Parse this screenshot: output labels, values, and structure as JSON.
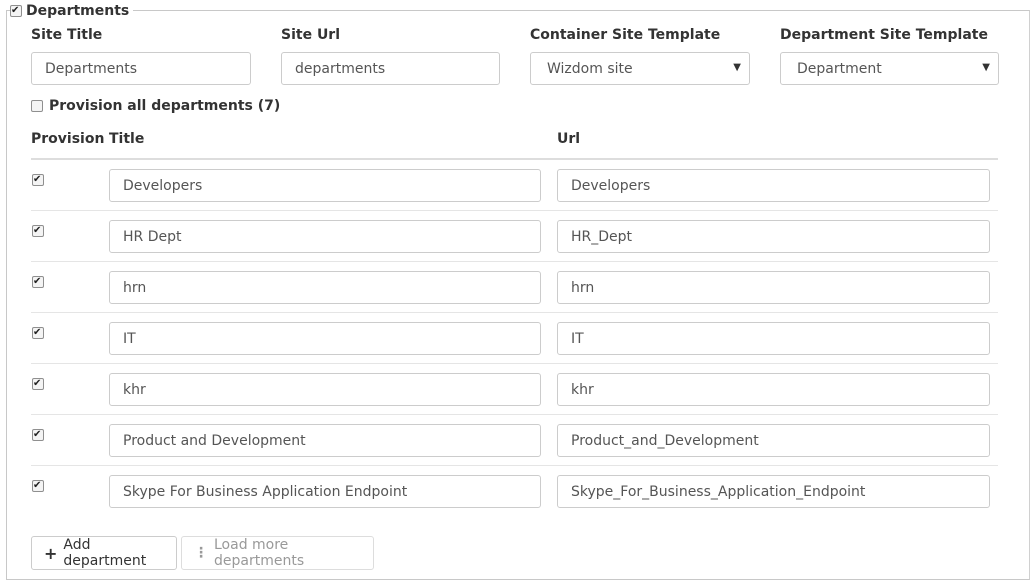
{
  "section": {
    "label": "Departments",
    "checked": true
  },
  "fields": {
    "site_title": {
      "label": "Site Title",
      "value": "Departments"
    },
    "site_url": {
      "label": "Site Url",
      "value": "departments"
    },
    "container_template": {
      "label": "Container Site Template",
      "value": "Wizdom site"
    },
    "department_template": {
      "label": "Department Site Template",
      "value": "Department"
    }
  },
  "provision_all": {
    "label": "Provision all departments (7)",
    "checked": false
  },
  "table": {
    "headers": {
      "provision": "Provision",
      "title": "Title",
      "url": "Url"
    },
    "rows": [
      {
        "checked": true,
        "title": "Developers",
        "url": "Developers"
      },
      {
        "checked": true,
        "title": "HR Dept",
        "url": "HR_Dept"
      },
      {
        "checked": true,
        "title": "hrn",
        "url": "hrn"
      },
      {
        "checked": true,
        "title": "IT",
        "url": "IT"
      },
      {
        "checked": true,
        "title": "khr",
        "url": "khr"
      },
      {
        "checked": true,
        "title": "Product and Development",
        "url": "Product_and_Development"
      },
      {
        "checked": true,
        "title": "Skype For Business Application Endpoint",
        "url": "Skype_For_Business_Application_Endpoint"
      }
    ]
  },
  "buttons": {
    "add": {
      "label": "Add department",
      "icon": "plus-icon"
    },
    "load_more": {
      "label": "Load more departments",
      "icon": "vertical-dots-icon"
    }
  },
  "icons": {
    "caret": "caret-down-icon"
  },
  "colors": {
    "border": "#cccccc",
    "text": "#333333",
    "muted": "#999999"
  }
}
